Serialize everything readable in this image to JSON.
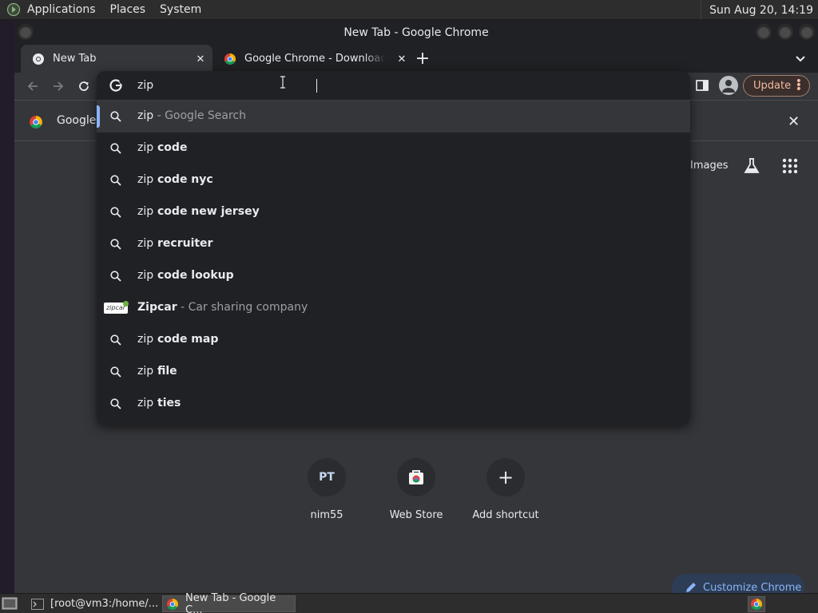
{
  "top_panel": {
    "menus": [
      "Applications",
      "Places",
      "System"
    ],
    "clock": "Sun Aug 20, 14:19"
  },
  "window": {
    "title": "New Tab - Google Chrome"
  },
  "tabs": [
    {
      "title": "New Tab",
      "active": true
    },
    {
      "title": "Google Chrome - Download th",
      "active": false
    }
  ],
  "toolbar": {
    "update_label": "Update"
  },
  "infobar": {
    "text": "Google C"
  },
  "omnibox": {
    "query": "zip",
    "suggestions": [
      {
        "prefix": "zip",
        "rest": "",
        "desc": " - Google Search",
        "icon": "search-icon",
        "selected": true
      },
      {
        "prefix": "zip",
        "rest": " code",
        "desc": "",
        "icon": "search-icon"
      },
      {
        "prefix": "zip",
        "rest": " code nyc",
        "desc": "",
        "icon": "search-icon"
      },
      {
        "prefix": "zip",
        "rest": " code new jersey",
        "desc": "",
        "icon": "search-icon"
      },
      {
        "prefix": "zip",
        "rest": " recruiter",
        "desc": "",
        "icon": "search-icon"
      },
      {
        "prefix": "zip",
        "rest": " code lookup",
        "desc": "",
        "icon": "search-icon"
      },
      {
        "prefix": "Zipcar",
        "rest": "",
        "desc": " - Car sharing company",
        "icon": "zipcar-logo",
        "logo_text": "zipcar"
      },
      {
        "prefix": "zip",
        "rest": " code map",
        "desc": "",
        "icon": "search-icon"
      },
      {
        "prefix": "zip",
        "rest": " file",
        "desc": "",
        "icon": "search-icon"
      },
      {
        "prefix": "zip",
        "rest": " ties",
        "desc": "",
        "icon": "search-icon"
      }
    ]
  },
  "ntp": {
    "images_link": "Images",
    "shortcuts": [
      {
        "label": "nim55",
        "badge": "PT"
      },
      {
        "label": "Web Store",
        "badge": ""
      },
      {
        "label": "Add shortcut",
        "badge": "+"
      }
    ],
    "customize_label": "Customize Chrome"
  },
  "taskbar": {
    "items": [
      {
        "label": "[root@vm3:/home/...",
        "active": false
      },
      {
        "label": "New Tab - Google C...",
        "active": true
      }
    ]
  },
  "colors": {
    "accent": "#8ab4f8",
    "update_text": "#f2b8a2",
    "omnibox_bg": "#202124",
    "page_bg": "#35363a"
  }
}
